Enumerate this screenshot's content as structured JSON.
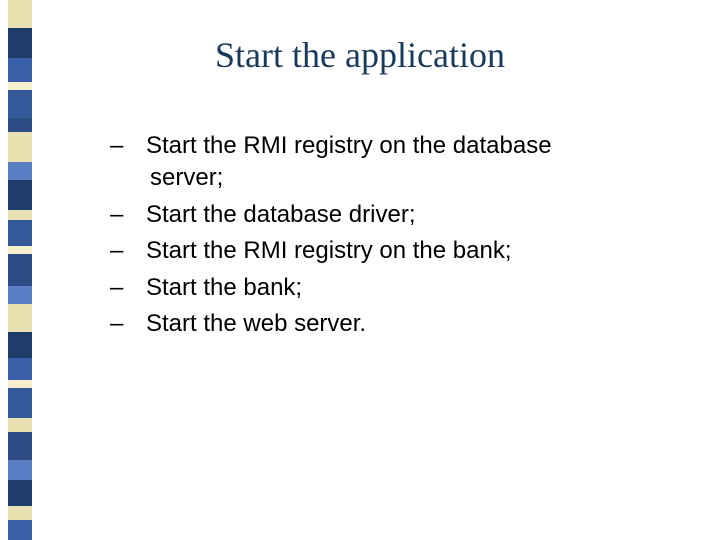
{
  "title": "Start the application",
  "items": [
    "Start the RMI registry on the database server;",
    "Start the database driver;",
    "Start the RMI registry on the bank;",
    "Start the bank;",
    "Start the web server."
  ],
  "sidebar_colors": [
    {
      "c": "#e8e0b0",
      "h": 28
    },
    {
      "c": "#1f3d6b",
      "h": 30
    },
    {
      "c": "#3a5fa8",
      "h": 24
    },
    {
      "c": "#f5efce",
      "h": 8
    },
    {
      "c": "#355a9c",
      "h": 28
    },
    {
      "c": "#2d4c85",
      "h": 14
    },
    {
      "c": "#e8e0b0",
      "h": 30
    },
    {
      "c": "#5a7fc4",
      "h": 18
    },
    {
      "c": "#1f3d6b",
      "h": 30
    },
    {
      "c": "#e8e0b0",
      "h": 10
    },
    {
      "c": "#355a9c",
      "h": 26
    },
    {
      "c": "#f5efce",
      "h": 8
    },
    {
      "c": "#2d4c85",
      "h": 32
    },
    {
      "c": "#5a7fc4",
      "h": 18
    },
    {
      "c": "#e8e0b0",
      "h": 28
    },
    {
      "c": "#1f3d6b",
      "h": 26
    },
    {
      "c": "#3a5fa8",
      "h": 22
    },
    {
      "c": "#f5efce",
      "h": 8
    },
    {
      "c": "#355a9c",
      "h": 30
    },
    {
      "c": "#e8e0b0",
      "h": 14
    },
    {
      "c": "#2d4c85",
      "h": 28
    },
    {
      "c": "#5a7fc4",
      "h": 20
    },
    {
      "c": "#1f3d6b",
      "h": 26
    },
    {
      "c": "#e8e0b0",
      "h": 14
    },
    {
      "c": "#3a5fa8",
      "h": 20
    }
  ]
}
